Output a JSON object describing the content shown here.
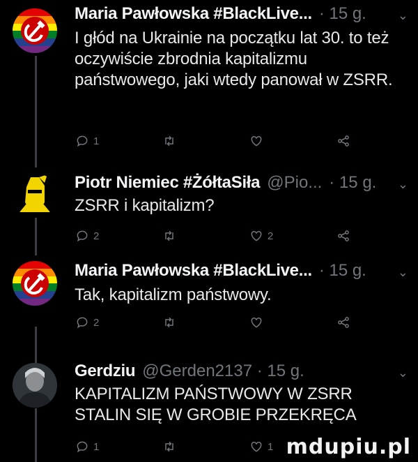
{
  "tweets": [
    {
      "name": "Maria Pawłowska #BlackLive...",
      "handle": "",
      "time": "· 15 g.",
      "text": "I głód na Ukrainie na początku lat 30. to też oczywiście zbrodnia kapitalizmu państwowego, jaki wtedy panował w ZSRR.",
      "replies": "1",
      "retweets": "",
      "likes": ""
    },
    {
      "name": "Piotr Niemiec #ŻółtaSiła",
      "handle": "@Pio...",
      "time": "· 15 g.",
      "text": "ZSRR i kapitalizm?",
      "replies": "2",
      "retweets": "",
      "likes": "2"
    },
    {
      "name": "Maria Pawłowska #BlackLive...",
      "handle": "",
      "time": "· 15 g.",
      "text": "Tak, kapitalizm państwowy.",
      "replies": "2",
      "retweets": "",
      "likes": ""
    },
    {
      "name": "Gerdziu",
      "handle": "@Gerden2137 · 15 g.",
      "time": "",
      "text": "KAPITALIZM PAŃSTWOWY W ZSRR STALIN SIĘ W GROBIE PRZEKRĘCA",
      "replies": "1",
      "retweets": "",
      "likes": "1"
    }
  ],
  "icons": {
    "reply": "reply-icon",
    "retweet": "retweet-icon",
    "like": "heart-icon",
    "share": "share-icon",
    "more": "chevron-down-icon"
  },
  "watermark": "mdupiu.pl"
}
